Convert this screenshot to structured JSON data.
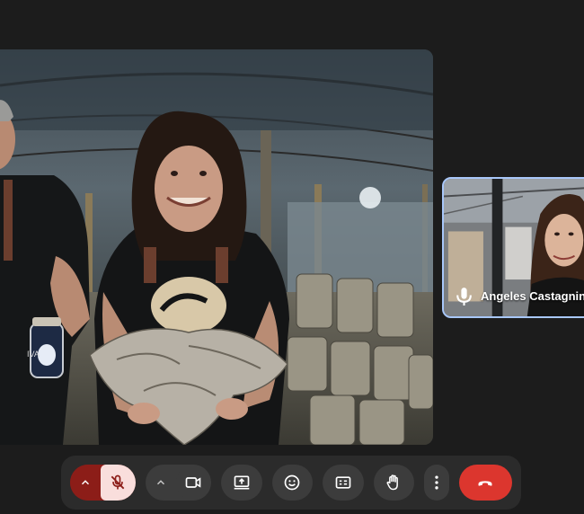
{
  "participants": {
    "self": {
      "name": "Angeles Castagnino"
    }
  },
  "jar_label": "IVA",
  "colors": {
    "background": "#1c1c1c",
    "control_bar": "#2b2b2b",
    "button": "#3c3c3c",
    "mic_muted_group": "#8c1d18",
    "mic_muted_button": "#f9dedc",
    "end_call": "#dc362e",
    "self_border": "#a8c7fa"
  },
  "controls": {
    "mic_options": {
      "icon": "chevron-up-icon"
    },
    "mic": {
      "icon": "mic-off-icon",
      "state": "muted"
    },
    "camera_options": {
      "icon": "chevron-up-icon"
    },
    "camera": {
      "icon": "videocam-icon"
    },
    "present": {
      "icon": "present-screen-icon"
    },
    "reactions": {
      "icon": "emoji-icon"
    },
    "captions": {
      "icon": "captions-icon"
    },
    "raise_hand": {
      "icon": "hand-icon"
    },
    "more": {
      "icon": "more-vertical-icon"
    },
    "end_call": {
      "icon": "call-end-icon"
    }
  }
}
